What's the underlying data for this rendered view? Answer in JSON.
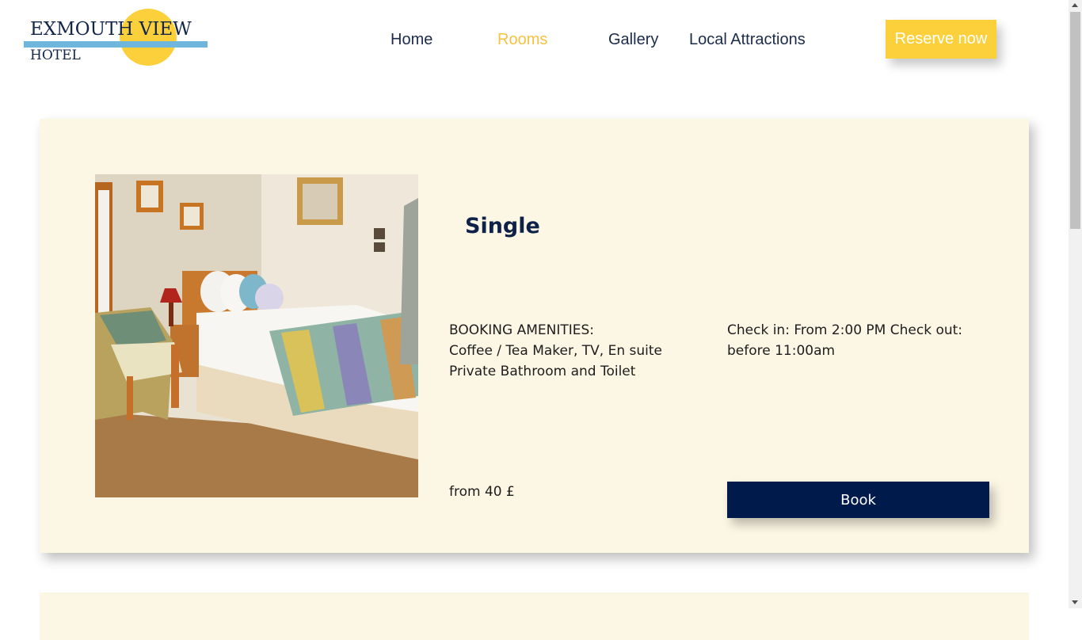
{
  "logo": {
    "title": "EXMOUTH VIEW",
    "subtitle": "HOTEL"
  },
  "nav": {
    "items": [
      {
        "label": "Home",
        "active": false
      },
      {
        "label": "Rooms",
        "active": true
      },
      {
        "label": "Gallery",
        "active": false
      },
      {
        "label": "Local Attractions",
        "active": false
      }
    ],
    "cta": "Reserve now"
  },
  "room": {
    "title": "Single",
    "amenities_heading": "BOOKING AMENITIES:",
    "amenities": "Coffee / Tea Maker, TV, En suite Private Bathroom and Toilet",
    "checkin": "Check in: From 2:00 PM Check out: before 11:00am",
    "price": "from 40 £",
    "book_label": "Book"
  },
  "colors": {
    "accent_yellow": "#fcd03a",
    "navy": "#001a4b",
    "card_bg": "#fcf6e4",
    "logo_blue": "#6fb6dc"
  }
}
